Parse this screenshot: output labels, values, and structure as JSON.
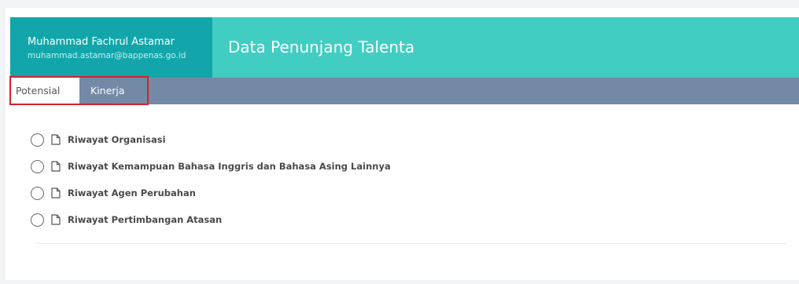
{
  "header": {
    "user_name": "Muhammad Fachrul Astamar",
    "user_email": "muhammad.astamar@bappenas.go.id",
    "title": "Data Penunjang Talenta"
  },
  "tabs": [
    {
      "label": "Potensial",
      "active": true
    },
    {
      "label": "Kinerja",
      "active": false
    }
  ],
  "items": [
    {
      "label": "Riwayat Organisasi",
      "icon": "document-icon",
      "selected": false
    },
    {
      "label": "Riwayat Kemampuan Bahasa Inggris dan Bahasa Asing Lainnya",
      "icon": "document-icon",
      "selected": false
    },
    {
      "label": "Riwayat Agen Perubahan",
      "icon": "document-icon",
      "selected": false
    },
    {
      "label": "Riwayat Pertimbangan Atasan",
      "icon": "document-icon",
      "selected": false
    }
  ],
  "colors": {
    "user_box": "#12a6ab",
    "title_bar": "#42cdc2",
    "tab_bar": "#7489a5",
    "highlight": "#d6202a"
  }
}
